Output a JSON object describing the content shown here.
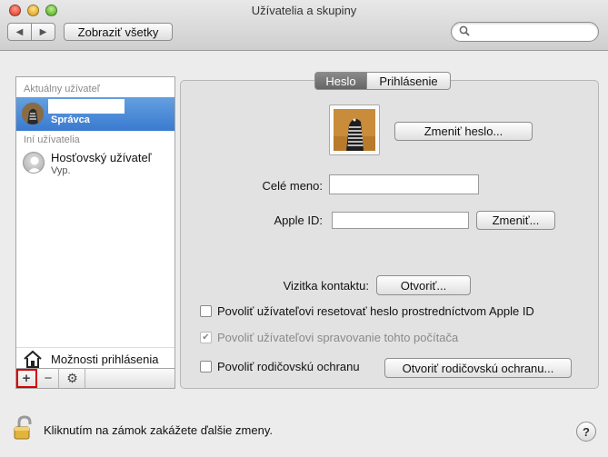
{
  "window": {
    "title": "Užívatelia a skupiny"
  },
  "toolbar": {
    "back_icon": "chevron-left-icon",
    "forward_icon": "chevron-right-icon",
    "show_all_label": "Zobraziť všetky",
    "search": {
      "value": "",
      "placeholder": ""
    }
  },
  "sidebar": {
    "current_header": "Aktuálny užívateľ",
    "current_user": {
      "name": "",
      "role": "Správca"
    },
    "other_header": "Iní užívatelia",
    "guest_user": {
      "name": "Hosťovský užívateľ",
      "status": "Vyp."
    },
    "login_options_label": "Možnosti prihlásenia",
    "bottom_buttons": [
      "+",
      "−",
      "⚙"
    ]
  },
  "tabs": [
    {
      "label": "Heslo",
      "selected": true
    },
    {
      "label": "Prihlásenie",
      "selected": false
    }
  ],
  "main": {
    "change_password_label": "Zmeniť heslo...",
    "full_name_label": "Celé meno:",
    "full_name_value": "",
    "apple_id_label": "Apple ID:",
    "apple_id_value": "",
    "change_apple_id_label": "Zmeniť...",
    "contact_card_label": "Vizitka kontaktu:",
    "open_card_label": "Otvoriť...",
    "checkboxes": [
      {
        "label": "Povoliť užívateľovi resetovať heslo prostredníctvom Apple ID",
        "checked": false,
        "enabled": true
      },
      {
        "label": "Povoliť užívateľovi spravovanie tohto počítača",
        "checked": true,
        "enabled": false
      },
      {
        "label": "Povoliť rodičovskú ochranu",
        "checked": false,
        "enabled": true
      }
    ],
    "open_parental_label": "Otvoriť rodičovskú ochranu..."
  },
  "footer": {
    "lock_text": "Kliknutím na zámok zakážete ďalšie zmeny.",
    "help_label": "?"
  },
  "colors": {
    "selection": "#3a7bd0",
    "highlight_outline": "#d40000"
  }
}
